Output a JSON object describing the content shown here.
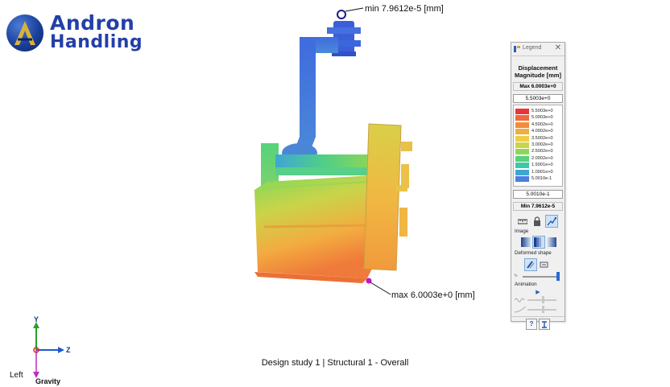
{
  "logo": {
    "word_top": "Andron",
    "word_bottom": "Handling",
    "brand_color": "#233fa8"
  },
  "probes": {
    "min_label": "min  7.9612e-5  [mm]",
    "max_label": "max  6.0003e+0  [mm]",
    "min_marker_color": "#1a1a8a",
    "max_marker_color": "#c414c4"
  },
  "legend": {
    "title": "Legend",
    "close_glyph": "✕",
    "quantity_line1": "Displacement",
    "quantity_line2": "Magnitude [mm]",
    "max_label": "Max  6.0003e+0",
    "upper_value": "5.5003e+0",
    "ticks": [
      "5.5003e+0",
      "5.0003e+0",
      "4.5002e+0",
      "4.0002e+0",
      "3.5002e+0",
      "3.0002e+0",
      "2.5002e+0",
      "2.0002e+0",
      "1.5001e+0",
      "1.0001e+0",
      "5.0010e-1"
    ],
    "colors": [
      "#e8343a",
      "#ee6a3a",
      "#f08d3c",
      "#f2ad40",
      "#f0cc44",
      "#c9d44a",
      "#8fd656",
      "#55d27a",
      "#3ec8a8",
      "#3fa6d4",
      "#4a7ee0"
    ],
    "lower_value": "5.0010e-1",
    "min_label": "Min  7.9612e-5",
    "image_section": "Image",
    "deformed_section": "Deformed shape",
    "animation_section": "Animation",
    "play_glyph": "▶",
    "help_glyph": "?",
    "icons": [
      "ruler-icon",
      "lock-icon",
      "probe-icon",
      "gradient-smooth-icon",
      "gradient-banded-icon",
      "gradient-fade-icon",
      "deformed-on-icon",
      "deformed-scaled-icon",
      "deformation-scale-slider",
      "play-icon",
      "help-icon",
      "pin-icon"
    ]
  },
  "triad": {
    "y_label": "Y",
    "z_label": "Z",
    "view_label": "Left",
    "gravity_label": "Gravity",
    "y_color": "#2aa02a",
    "z_color": "#1d5ad8",
    "x_color": "#d42a2a",
    "gravity_color": "#c02ac0"
  },
  "caption": "Design study 1 | Structural  1 - Overall"
}
